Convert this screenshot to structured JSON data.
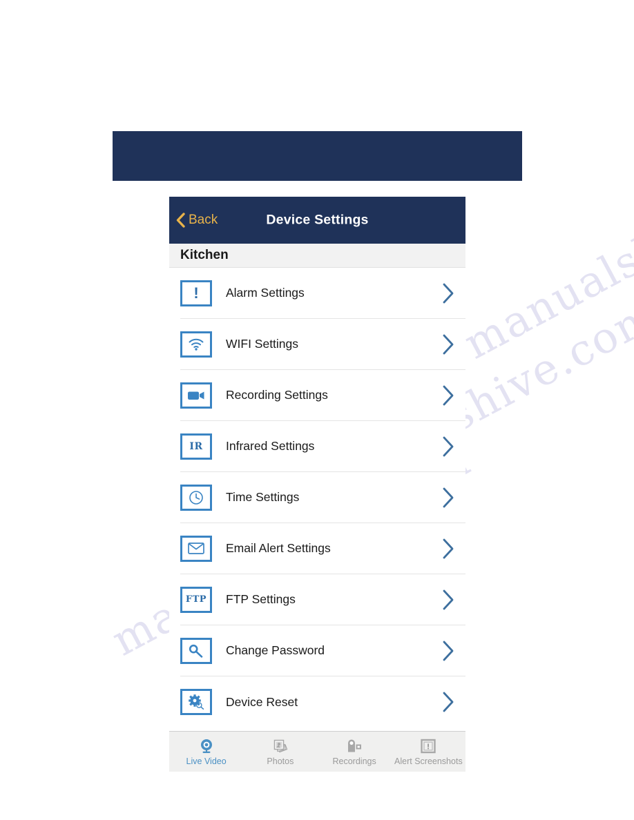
{
  "banner": {
    "color": "#1f3259"
  },
  "nav": {
    "back_label": "Back",
    "title": "Device Settings",
    "back_color": "#e8b34a",
    "bar_color": "#1f3259"
  },
  "section": {
    "label": "Kitchen"
  },
  "accent": {
    "icon_blue": "#3a84c3",
    "chevron_blue": "#3d6f9e",
    "tab_active": "#4a90c4"
  },
  "list": {
    "rows": [
      {
        "label": "Alarm Settings",
        "icon": "exclamation-icon"
      },
      {
        "label": "WIFI Settings",
        "icon": "wifi-icon"
      },
      {
        "label": "Recording Settings",
        "icon": "video-camera-icon"
      },
      {
        "label": "Infrared Settings",
        "icon": "ir-icon",
        "icon_text": "IR"
      },
      {
        "label": "Time Settings",
        "icon": "clock-icon"
      },
      {
        "label": "Email Alert Settings",
        "icon": "envelope-icon"
      },
      {
        "label": "FTP Settings",
        "icon": "ftp-icon",
        "icon_text": "FTP"
      },
      {
        "label": "Change Password",
        "icon": "key-icon"
      },
      {
        "label": "Device Reset",
        "icon": "gear-icon"
      }
    ]
  },
  "tabs": [
    {
      "label": "Live Video",
      "icon": "webcam-icon",
      "active": true
    },
    {
      "label": "Photos",
      "icon": "photos-icon",
      "active": false
    },
    {
      "label": "Recordings",
      "icon": "camcorder-icon",
      "active": false
    },
    {
      "label": "Alert Screenshots",
      "icon": "alert-frame-icon",
      "active": false
    }
  ],
  "watermark": {
    "line_a": "manualshive.com",
    "line_b": "manualshive.com",
    "line_c": "manualshive.com"
  }
}
